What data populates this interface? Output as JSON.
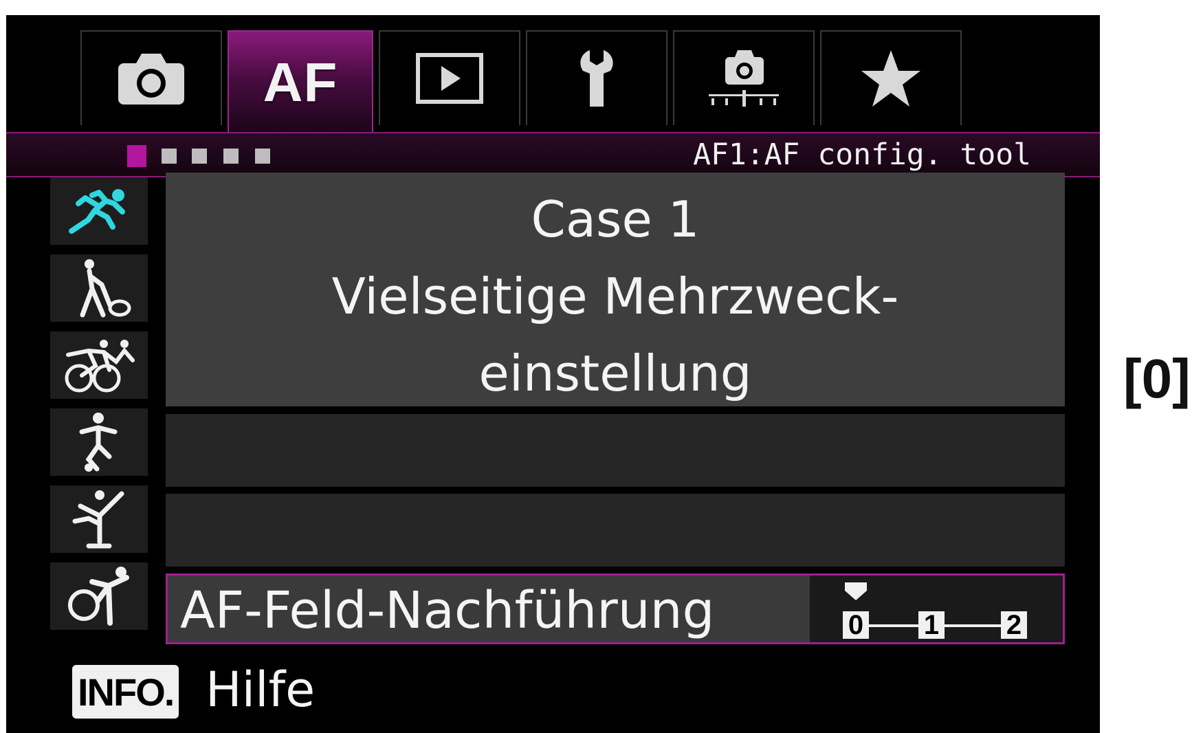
{
  "tabs": [
    {
      "name": "shooting",
      "icon": "camera-icon"
    },
    {
      "name": "af",
      "label": "AF",
      "active": true
    },
    {
      "name": "playback",
      "icon": "playback-icon"
    },
    {
      "name": "setup",
      "icon": "wrench-icon"
    },
    {
      "name": "custom-functions",
      "icon": "custom-camera-icon"
    },
    {
      "name": "my-menu",
      "icon": "star-icon"
    }
  ],
  "page_indicator": {
    "total": 5,
    "current": 1
  },
  "menu_title": "AF1:AF config. tool",
  "case_icons": [
    {
      "icon": "sprinter-icon",
      "selected": true
    },
    {
      "icon": "tennis-player-icon"
    },
    {
      "icon": "cyclists-icon"
    },
    {
      "icon": "soccer-player-icon"
    },
    {
      "icon": "figure-skater-icon"
    },
    {
      "icon": "gymnast-cyclist-icon"
    }
  ],
  "case": {
    "name": "Case 1",
    "description_line1": "Vielseitige Mehrzweck-",
    "description_line2": "einstellung"
  },
  "setting": {
    "label": "AF-Feld-Nachführung",
    "levels": [
      "0",
      "1",
      "2"
    ],
    "current_level": "0"
  },
  "footer": {
    "info_button": "INFO.",
    "help_label": "Hilfe"
  },
  "side_value": "[0]",
  "colors": {
    "accent": "#a0208e",
    "background": "#000000",
    "panel": "#3e3e3e"
  }
}
